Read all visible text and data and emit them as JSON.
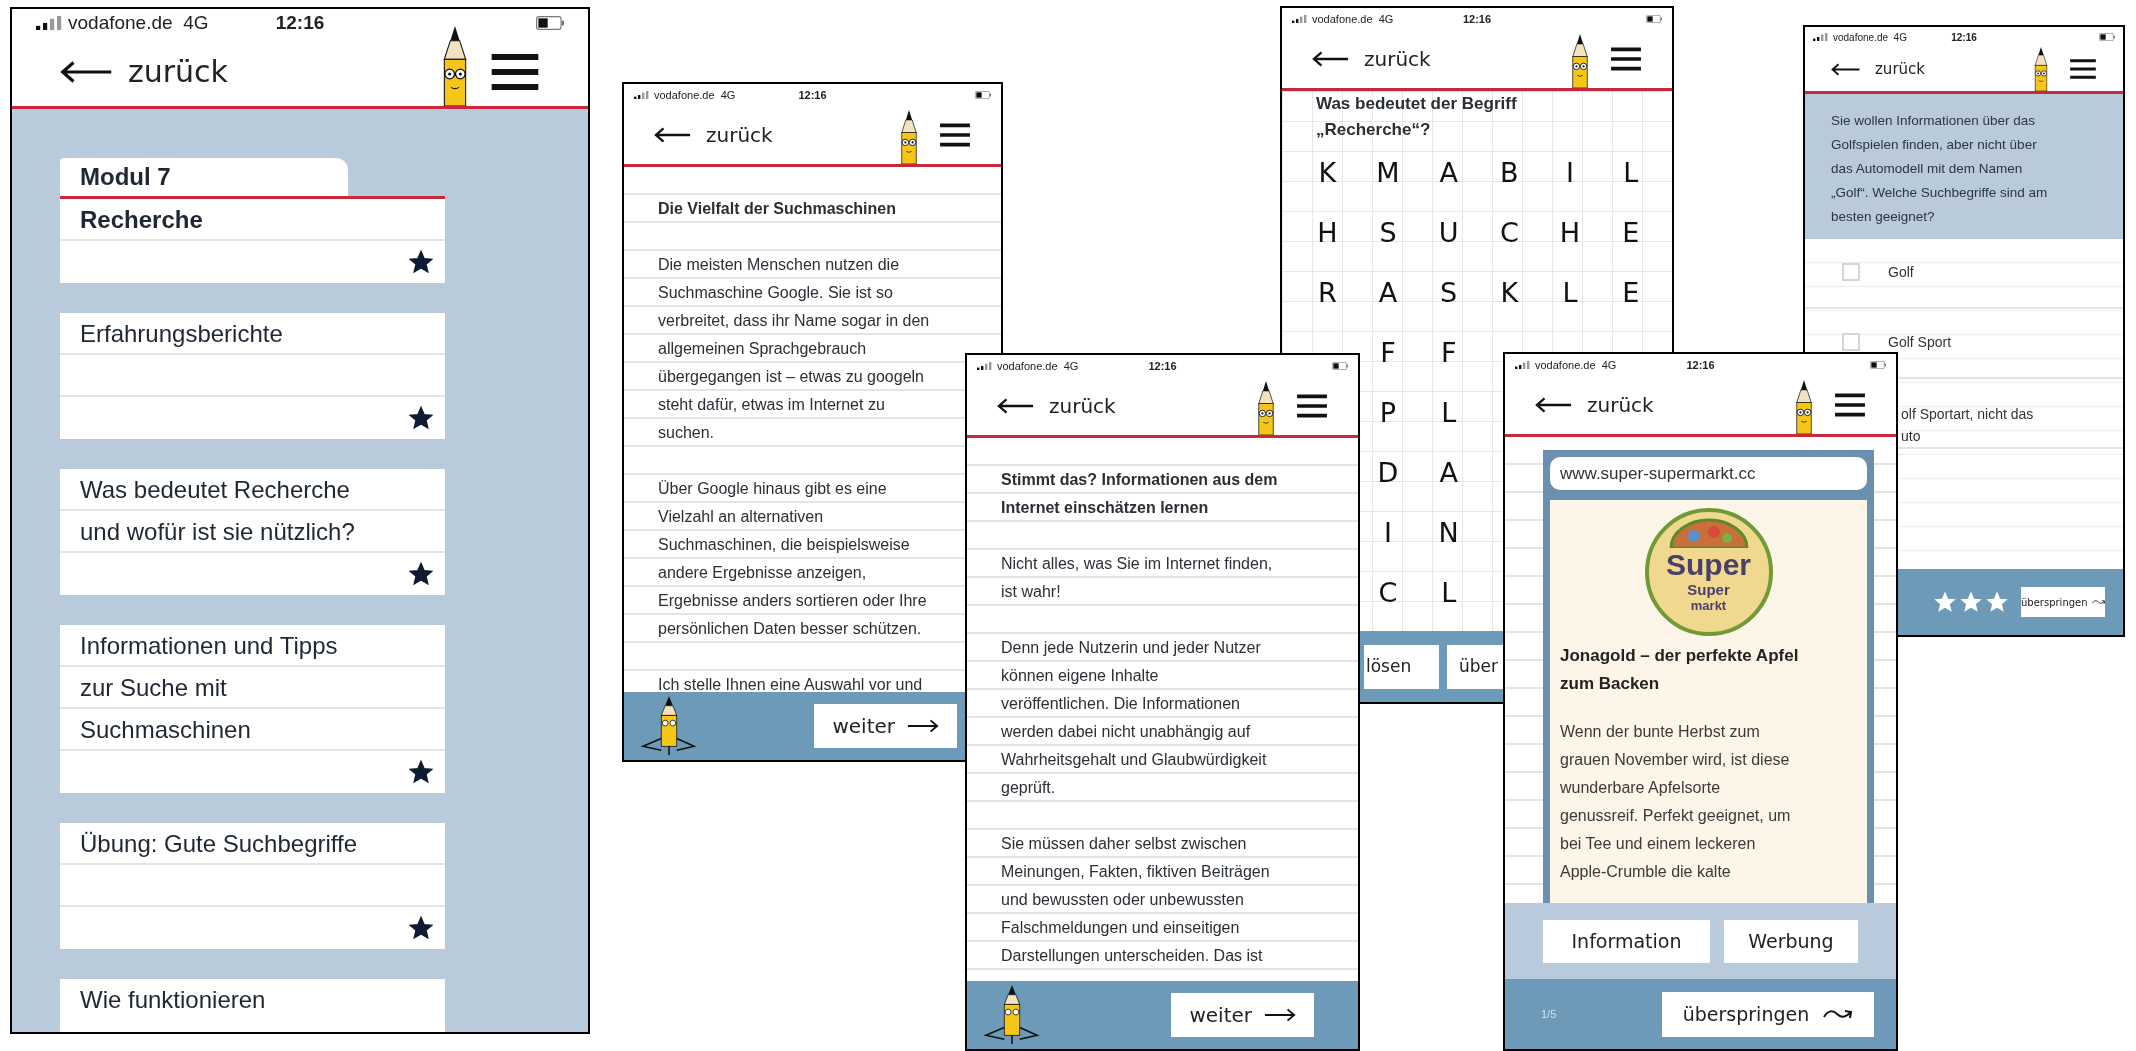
{
  "phones": [
    {
      "kind": "modules",
      "status": {
        "carrier": "vodafone.de  4G",
        "time": "12:16"
      },
      "back": "zurück",
      "module": {
        "tab": "Modul 7",
        "title": "Recherche",
        "starred": true
      },
      "lessons": [
        {
          "title": "Erfahrungsberichte",
          "starred": true
        },
        {
          "title": "Was bedeutet Recherche\nund wofür ist sie nützlich?",
          "starred": true
        },
        {
          "title": "Informationen und Tipps\nzur Suche mit\nSuchmaschinen",
          "starred": true
        },
        {
          "title": "Übung: Gute Suchbegriffe",
          "starred": true
        },
        {
          "title": "Wie funktionieren"
        }
      ]
    },
    {
      "kind": "article",
      "status": {
        "carrier": "vodafone.de  4G",
        "time": "12:16"
      },
      "back": "zurück",
      "title": "Die Vielfalt der Suchmaschinen",
      "paragraphs": [
        "Die meisten Menschen nutzen die\nSuchmaschine Google. Sie ist so\nverbreitet, dass ihr Name sogar in den\nallgemeinen Sprachgebrauch\nübergegangen ist – etwas zu googeln\nsteht dafür, etwas im Internet zu\nsuchen.",
        "Über Google hinaus gibt es eine\nVielzahl an alternativen\nSuchmaschinen, die beispielsweise\nandere Ergebnisse anzeigen,\nErgebnisse anders sortieren oder Ihre\npersönlichen Daten besser schützen.",
        "Ich stelle Ihnen eine Auswahl vor und"
      ],
      "next": "weiter"
    },
    {
      "kind": "article",
      "status": {
        "carrier": "vodafone.de  4G",
        "time": "12:16"
      },
      "back": "zurück",
      "title": "Stimmt das? Informationen aus dem\nInternet einschätzen lernen",
      "paragraphs": [
        "Nicht alles, was Sie im Internet finden,\nist wahr!",
        "Denn jede Nutzerin und jeder Nutzer\nkönnen eigene Inhalte\nveröffentlichen. Die Informationen\nwerden dabei nicht unabhängig auf\nWahrheitsgehalt und Glaubwürdigkeit\ngeprüft.",
        "Sie müssen daher selbst zwischen\nMeinungen, Fakten, fiktiven Beiträgen\nund bewussten oder unbewussten\nFalschmeldungen und einseitigen\nDarstellungen unterscheiden. Das ist"
      ],
      "next": "weiter"
    },
    {
      "kind": "grid",
      "status": {
        "carrier": "vodafone.de  4G",
        "time": "12:16"
      },
      "back": "zurück",
      "question": "Was bedeutet der Begriff\n„Recherche“?",
      "grid": [
        [
          "K",
          "M",
          "A",
          "B",
          "I",
          "L"
        ],
        [
          "H",
          "S",
          "U",
          "C",
          "H",
          "E"
        ],
        [
          "R",
          "A",
          "S",
          "K",
          "L",
          "E"
        ],
        [
          "F",
          "F"
        ],
        [
          "P",
          "L"
        ],
        [
          "D",
          "A"
        ],
        [
          "I",
          "N"
        ],
        [
          "C",
          "L"
        ]
      ],
      "buttons": [
        "lösen",
        "über"
      ]
    },
    {
      "kind": "website",
      "status": {
        "carrier": "vodafone.de  4G",
        "time": "12:16"
      },
      "back": "zurück",
      "url": "www.super-supermarkt.cc",
      "logo_text": [
        "Super",
        "Super",
        "markt"
      ],
      "headline": "Jonagold – der perfekte Apfel\nzum Backen",
      "body": "Wenn der bunte Herbst zum\ngrauen November wird, ist diese\nwunderbare Apfelsorte\ngenussreif. Perfekt geeignet, um\nbei Tee und einem leckeren\nApple-Crumble die kalte",
      "answers": [
        "Information",
        "Werbung"
      ],
      "counter": "1/5",
      "skip": "überspringen"
    },
    {
      "kind": "quiz",
      "status": {
        "carrier": "vodafone.de  4G",
        "time": "12:16"
      },
      "back": "zurück",
      "question": "Sie wollen Informationen über das\nGolfspielen finden, aber nicht über\ndas Automodell mit dem Namen\n„Golf“. Welche Suchbegriffe sind am\nbesten geeignet?",
      "options": [
        {
          "label": "Golf",
          "checked": false
        },
        {
          "label": "Golf Sport",
          "checked": false
        },
        {
          "label": "olf Sportart, nicht das\nuto"
        }
      ],
      "stars": 3,
      "skip": "überspringen"
    }
  ]
}
